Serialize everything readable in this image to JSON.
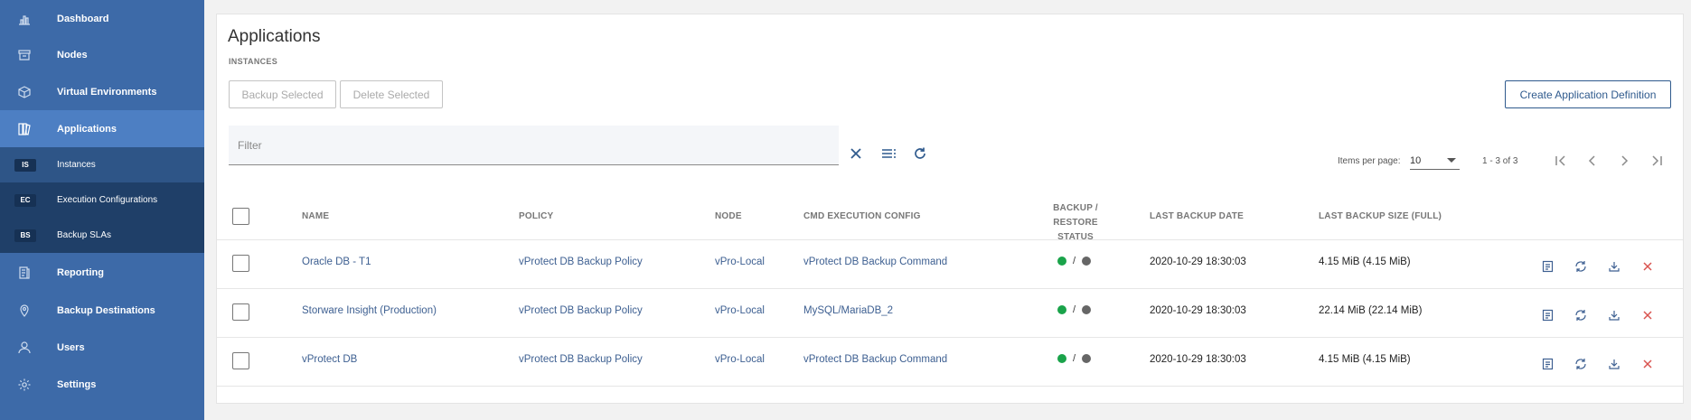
{
  "sidebar": {
    "items": [
      {
        "label": "Dashboard",
        "icon": "bar-chart-icon"
      },
      {
        "label": "Nodes",
        "icon": "archive-box-icon"
      },
      {
        "label": "Virtual Environments",
        "icon": "cube-icon"
      },
      {
        "label": "Applications",
        "icon": "stack-icon"
      },
      {
        "label": "Reporting",
        "icon": "report-icon"
      },
      {
        "label": "Backup Destinations",
        "icon": "location-pin-icon"
      },
      {
        "label": "Users",
        "icon": "user-icon"
      },
      {
        "label": "Settings",
        "icon": "gear-icon"
      }
    ],
    "subitems": [
      {
        "badge": "IS",
        "label": "Instances"
      },
      {
        "badge": "EC",
        "label": "Execution Configurations"
      },
      {
        "badge": "BS",
        "label": "Backup SLAs"
      }
    ]
  },
  "page": {
    "title": "Applications",
    "subtitle": "INSTANCES"
  },
  "toolbar": {
    "backup_selected": "Backup Selected",
    "delete_selected": "Delete Selected",
    "create_definition": "Create Application Definition"
  },
  "filter": {
    "placeholder": "Filter",
    "value": ""
  },
  "pagination": {
    "items_per_page_label": "Items per page:",
    "items_per_page": "10",
    "range": "1 - 3 of 3"
  },
  "table": {
    "columns": {
      "name": "NAME",
      "policy": "POLICY",
      "node": "NODE",
      "cmd": "CMD EXECUTION CONFIG",
      "status_line1": "BACKUP /",
      "status_line2": "RESTORE STATUS",
      "last_date": "LAST BACKUP DATE",
      "last_size": "LAST BACKUP SIZE (FULL)"
    },
    "rows": [
      {
        "name": "Oracle DB - T1",
        "policy": "vProtect DB Backup Policy",
        "node": "vPro-Local",
        "cmd": "vProtect DB Backup Command",
        "separator": "/",
        "date": "2020-10-29 18:30:03",
        "size": "4.15 MiB (4.15 MiB)"
      },
      {
        "name": "Storware Insight (Production)",
        "policy": "vProtect DB Backup Policy",
        "node": "vPro-Local",
        "cmd": "MySQL/MariaDB_2",
        "separator": "/",
        "date": "2020-10-29 18:30:03",
        "size": "22.14 MiB (22.14 MiB)"
      },
      {
        "name": "vProtect DB",
        "policy": "vProtect DB Backup Policy",
        "node": "vPro-Local",
        "cmd": "vProtect DB Backup Command",
        "separator": "/",
        "date": "2020-10-29 18:30:03",
        "size": "4.15 MiB (4.15 MiB)"
      }
    ]
  },
  "colors": {
    "sidebar": "#3d6aa8",
    "sidebar_active": "#4d7fc3",
    "link": "#3d5f91",
    "status_backup": "#1aa34a",
    "status_restore": "#666666",
    "delete": "#d9534f"
  }
}
